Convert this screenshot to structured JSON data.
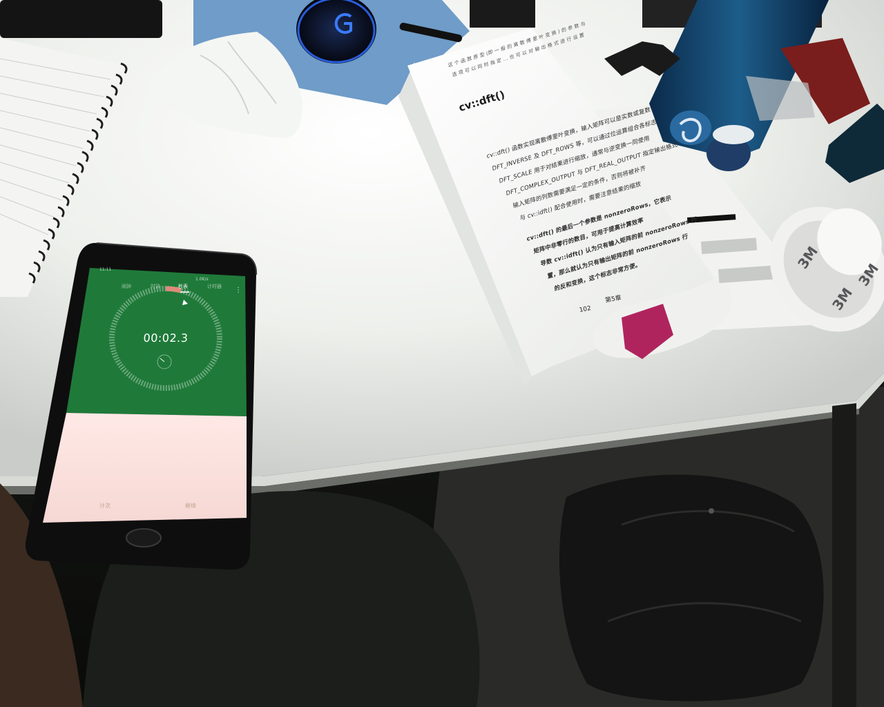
{
  "phone": {
    "status_time": "11:11",
    "status_right": "1.0K/s",
    "tabs": [
      "闹钟",
      "时钟",
      "秒表",
      "计时器"
    ],
    "active_tab_index": 2,
    "stopwatch_time": "00:02.3",
    "bottom_left_label": "计次",
    "bottom_right_label": "继续",
    "more_icon": "more-vertical-icon",
    "screen_color": "#1f7a39"
  },
  "book": {
    "top_lines": [
      "这 个 函 数 原 型 (即 一 般 的 离 散 傅 里 叶 变 换 ) 的 参 数 与",
      "选 项 可 以 同 时 指 定 ... 也 可 以 对 输 出 格 式 进 行 设 置"
    ],
    "heading": "cv::dft()",
    "body_lines": [
      "cv::dft() 函数实现离散傅里叶变换，输入矩阵可以是实数或复数",
      "DFT_INVERSE 及 DFT_ROWS 等，可以通过位运算组合各标志",
      "DFT_SCALE 用于对结果进行缩放，通常与逆变换一同使用",
      "DFT_COMPLEX_OUTPUT 与 DFT_REAL_OUTPUT 指定输出格式",
      "输入矩阵的列数需要满足一定的条件，否则将被补齐",
      "与 cv::idft() 配合使用时，需要注意结果的缩放",
      "cv::dft() 的最后一个参数是 nonzeroRows，它表示",
      "矩阵中非零行的数目，可用于提高计算效率",
      "导数 cv::idft() 认为只有输入矩阵的前 nonzeroRows 行",
      "置，那么就认为只有输出矩阵的前 nonzeroRows 行",
      "的反和变换，这个标志非常方便。"
    ],
    "page_number": "102",
    "chapter": "第5章"
  },
  "tape": {
    "label": "3M"
  },
  "mouse": {
    "logo_icon": "logitech-g-logo",
    "glow_color": "#2f6cff"
  }
}
